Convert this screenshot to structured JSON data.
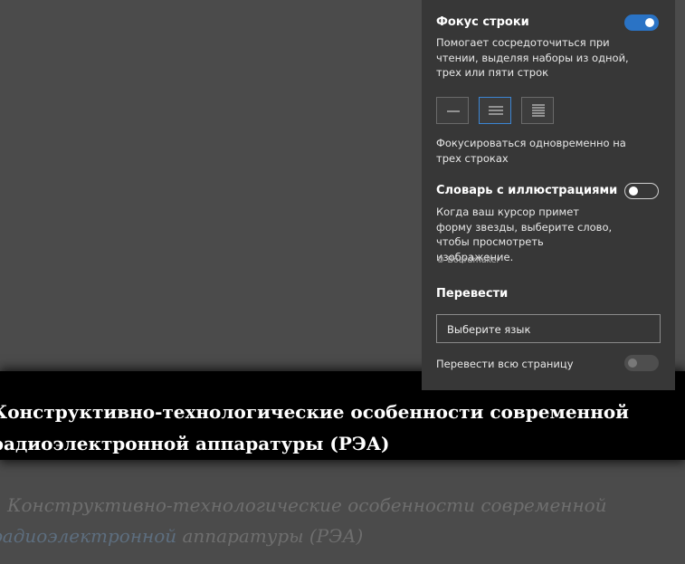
{
  "reader": {
    "focused_line1": "Конструктивно-технологические особенности современной",
    "focused_line2": "радиоэлектронной аппаратуры (РЭА)",
    "dim_line1": "Конструктивно-технологические особенности современной",
    "dim_line2_link": "радиоэлектронной",
    "dim_line2_rest": " аппаратуры (РЭА)"
  },
  "panel": {
    "line_focus": {
      "title": "Фокус строки",
      "enabled": true,
      "description": "Помогает сосредоточиться при чтении, выделяя наборы из одной, трех или пяти строк",
      "options": [
        1,
        3,
        5
      ],
      "selected": 3,
      "status": "Фокусироваться одновременно на трех строках"
    },
    "picture_dictionary": {
      "title": "Словарь с иллюстрациями",
      "enabled": false,
      "description": "Когда ваш курсор примет форму звезды, выберите слово, чтобы просмотреть изображение.",
      "credit": "© Boardmaker"
    },
    "translate": {
      "title": "Перевести",
      "language_placeholder": "Выберите язык",
      "whole_page_label": "Перевести всю страницу",
      "whole_page_enabled": false
    }
  },
  "colors": {
    "accent": "#2a73c5",
    "panel_bg": "#373737",
    "reader_bg": "#4b4b4b",
    "focus_band": "#000000"
  }
}
